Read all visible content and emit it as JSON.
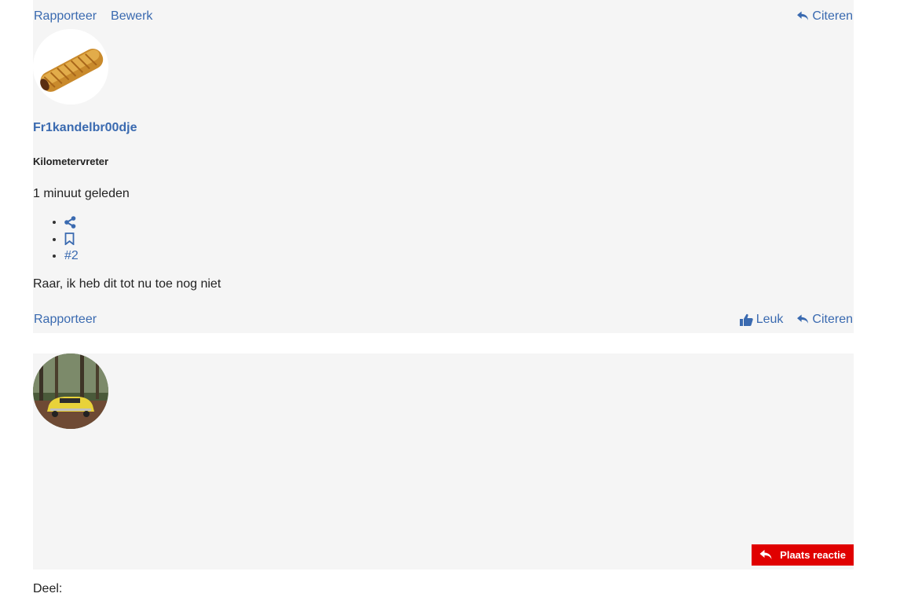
{
  "post1": {
    "top_actions": {
      "report": "Rapporteer",
      "edit": "Bewerk",
      "quote": "Citeren"
    },
    "avatar_icon": "sausage-roll-avatar",
    "username": "Fr1kandelbr00dje",
    "rank": "Kilometervreter",
    "time": "1 minuut geleden",
    "actions": {
      "share_icon": "share-icon",
      "bookmark_icon": "bookmark-icon",
      "post_number": "#2"
    },
    "body": "Raar, ik heb dit tot nu toe nog niet",
    "bottom_actions": {
      "report": "Rapporteer",
      "like": "Leuk",
      "quote": "Citeren"
    }
  },
  "post2": {
    "avatar_icon": "yellow-car-forest-avatar",
    "reply_button": "Plaats reactie"
  },
  "share_label": "Deel:",
  "colors": {
    "link": "#3a6ab0",
    "panel": "#f5f5f5",
    "reply": "#e00000"
  }
}
